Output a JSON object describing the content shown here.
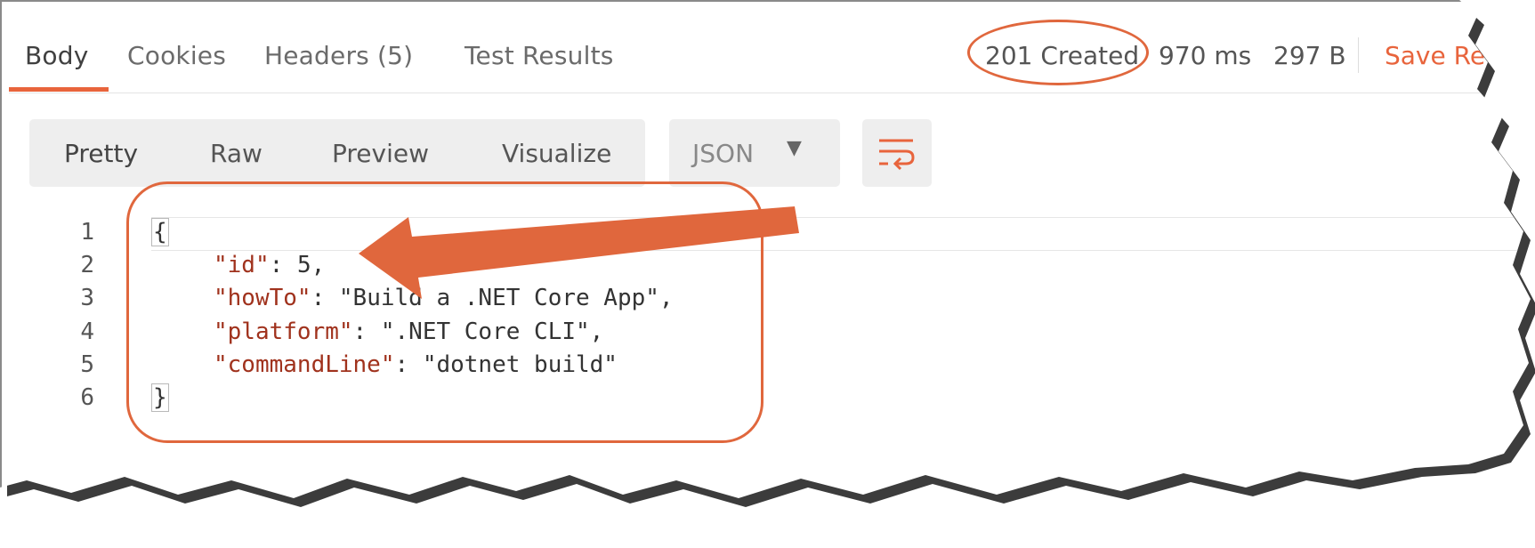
{
  "tabs": [
    {
      "label": "Body"
    },
    {
      "label": "Cookies"
    },
    {
      "label": "Headers (5)"
    },
    {
      "label": "Test Results"
    }
  ],
  "response_meta": {
    "status": "201 Created",
    "time": "970 ms",
    "size": "297 B",
    "save_label": "Save Re"
  },
  "view_modes": [
    {
      "label": "Pretty"
    },
    {
      "label": "Raw"
    },
    {
      "label": "Preview"
    },
    {
      "label": "Visualize"
    }
  ],
  "format_select": {
    "value": "JSON"
  },
  "code": {
    "line_numbers": [
      "1",
      "2",
      "3",
      "4",
      "5",
      "6"
    ],
    "open_brace": "{",
    "close_brace": "}",
    "fields": [
      {
        "key": "\"id\"",
        "sep": ": ",
        "value": "5",
        "trail": ","
      },
      {
        "key": "\"howTo\"",
        "sep": ": ",
        "value": "\"Build a .NET Core App\"",
        "trail": ","
      },
      {
        "key": "\"platform\"",
        "sep": ": ",
        "value": "\".NET Core CLI\"",
        "trail": ","
      },
      {
        "key": "\"commandLine\"",
        "sep": ": ",
        "value": "\"dotnet build\"",
        "trail": ""
      }
    ]
  },
  "colors": {
    "accent": "#e8643c",
    "annotation": "#e0673d",
    "json_key": "#a0321d"
  },
  "icons": {
    "wrap_toggle": "wrap-lines-icon",
    "format_caret": "caret-down-icon"
  }
}
